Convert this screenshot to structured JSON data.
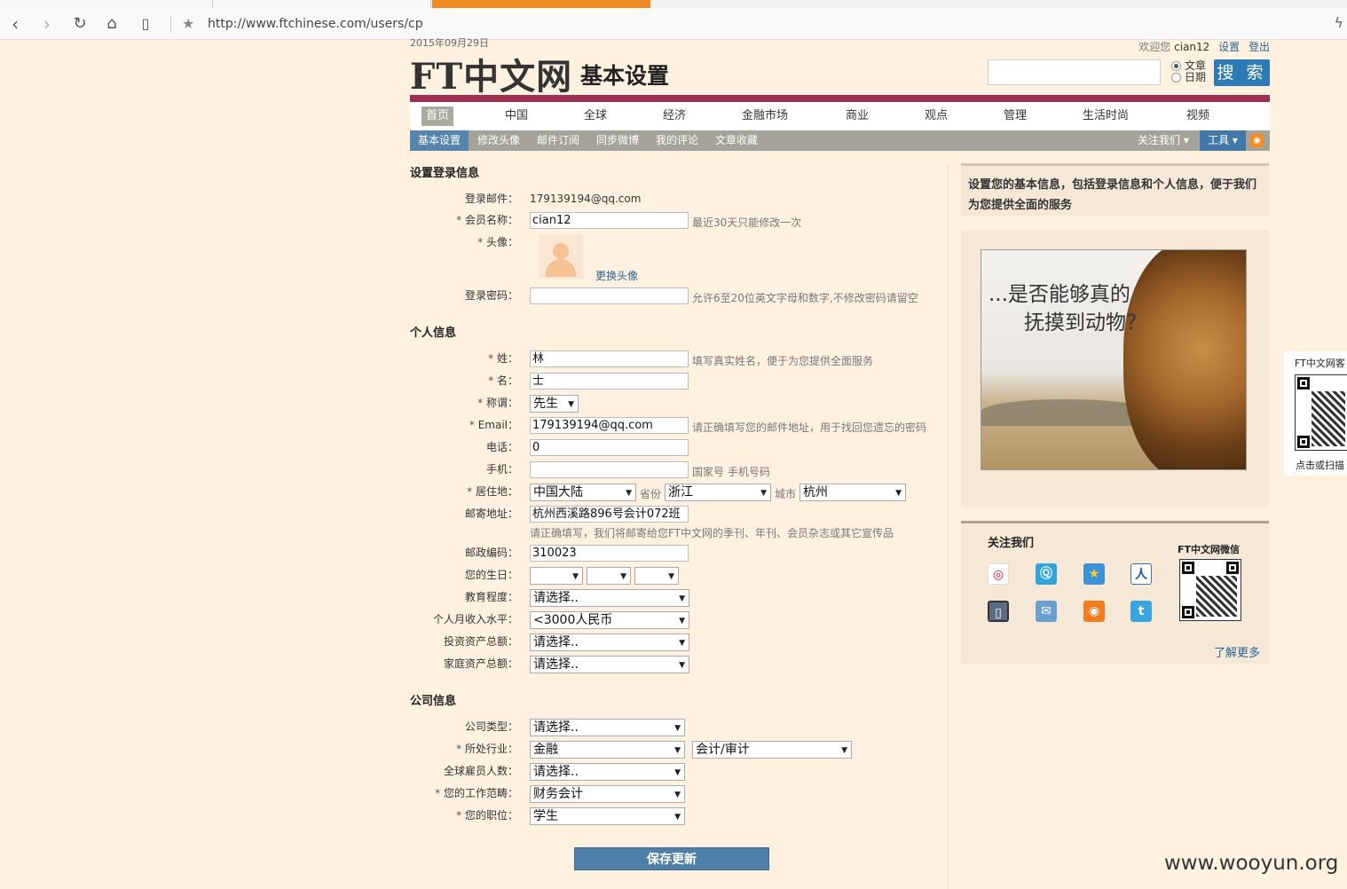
{
  "browser": {
    "url": "http://www.ftchinese.com/users/cp"
  },
  "header": {
    "date": "2015年09月29日",
    "logo": "FT中文网",
    "page_title": "基本设置",
    "welcome": "欢迎您",
    "username": "cian12",
    "settings_link": "设置",
    "logout_link": "登出",
    "search_options": [
      "文章",
      "日期"
    ],
    "search_button": "搜 索"
  },
  "main_nav": [
    "首页",
    "中国",
    "全球",
    "经济",
    "金融市场",
    "商业",
    "观点",
    "管理",
    "生活时尚",
    "视频"
  ],
  "sub_nav": [
    "基本设置",
    "修改头像",
    "邮件订阅",
    "同步微博",
    "我的评论",
    "文章收藏"
  ],
  "sub_nav_right": {
    "follow": "关注我们 ▾",
    "tools": "工具 ▾"
  },
  "login_section": {
    "heading": "设置登录信息",
    "email_label": "登录邮件：",
    "email_value": "179139194@qq.com",
    "nickname_label": "会员名称：",
    "nickname_value": "cian12",
    "nickname_hint": "最近30天只能修改一次",
    "avatar_label": "头像：",
    "change_avatar": "更换头像",
    "password_label": "登录密码：",
    "password_value": "",
    "password_hint": "允许6至20位英文字母和数字,不修改密码请留空"
  },
  "personal_section": {
    "heading": "个人信息",
    "surname_label": "姓：",
    "surname_value": "林",
    "surname_hint": "填写真实姓名，便于为您提供全面服务",
    "given_label": "名：",
    "given_value": "士",
    "title_label": "称谓：",
    "title_value": "先生",
    "email_label": "Email：",
    "email_value": "179139194@qq.com",
    "email_hint": "请正确填写您的邮件地址，用于找回您遗忘的密码",
    "phone_label": "电话：",
    "phone_value": "0",
    "mobile_label": "手机：",
    "mobile_value": "",
    "mobile_hint": "国家号 手机号码",
    "residence_label": "居住地：",
    "country_value": "中国大陆",
    "province_label": "省份",
    "province_value": "浙江",
    "city_label": "城市",
    "city_value": "杭州",
    "address_label": "邮寄地址：",
    "address_value": "杭州西溪路896号会计072班",
    "address_hint": "请正确填写，我们将邮寄给您FT中文网的季刊、年刊、会员杂志或其它宣传品",
    "zip_label": "邮政编码：",
    "zip_value": "310023",
    "birthday_label": "您的生日：",
    "education_label": "教育程度：",
    "education_value": "请选择..",
    "income_label": "个人月收入水平：",
    "income_value": "<3000人民币",
    "invest_label": "投资资产总额：",
    "invest_value": "请选择..",
    "family_label": "家庭资产总额：",
    "family_value": "请选择.."
  },
  "company_section": {
    "heading": "公司信息",
    "type_label": "公司类型：",
    "type_value": "请选择..",
    "industry_label": "所处行业：",
    "industry_value": "金融",
    "industry_sub_value": "会计/审计",
    "employees_label": "全球雇员人数：",
    "employees_value": "请选择..",
    "scope_label": "您的工作范畴：",
    "scope_value": "财务会计",
    "position_label": "您的职位：",
    "position_value": "学生",
    "save_button": "保存更新"
  },
  "sidebar": {
    "info_text": "设置您的基本信息，包括登录信息和个人信息，便于我们为您提供全面的服务",
    "ad_line1": "...是否能够真的",
    "ad_line2": "抚摸到动物？",
    "follow_title": "关注我们",
    "wechat_title": "FT中文网微信",
    "more_link": "了解更多",
    "social_icons": [
      "weibo-icon",
      "tencent-weibo-icon",
      "star-icon",
      "renren-icon",
      "mobile-icon",
      "email-icon",
      "rss-icon",
      "twitter-icon"
    ]
  },
  "side_widget": {
    "top_text": "FT中文网客",
    "bottom_text": "点击或扫描"
  },
  "watermark": "www.wooyun.org"
}
